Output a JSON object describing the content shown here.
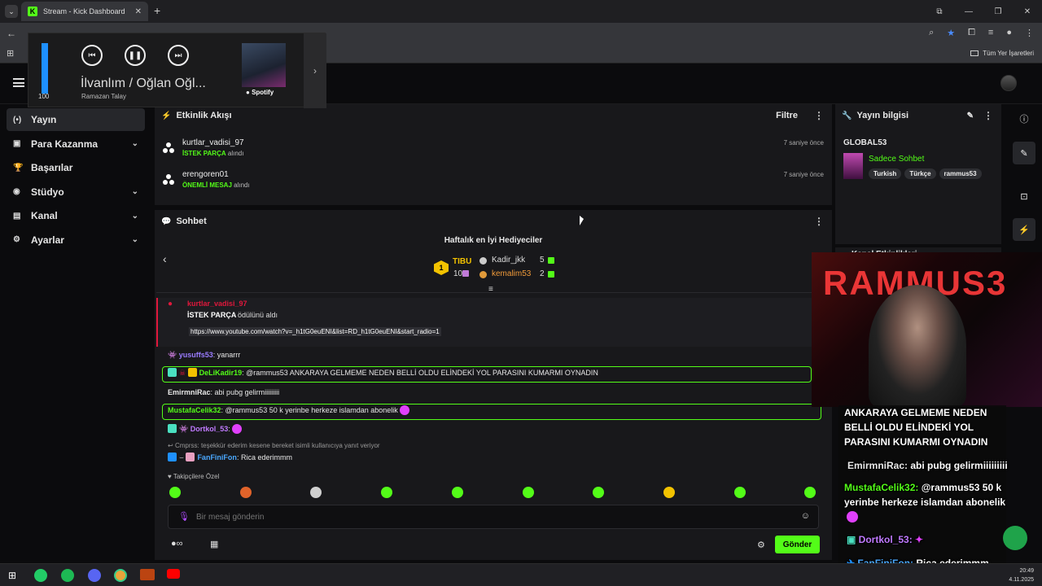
{
  "browser": {
    "tab_title": "Stream - Kick Dashboard",
    "tab_close": "✕",
    "bookmarks_all": "Tüm Yer İşaretleri"
  },
  "spotify": {
    "volume": 100,
    "track": "İlvanlım / Oğlan Oğl...",
    "artist": "Ramazan Talay",
    "brand": "Spotify"
  },
  "sidebar": {
    "items": [
      {
        "label": "Yayın",
        "icon": "broadcast-icon",
        "glyph": "(•)",
        "active": true,
        "expandable": false
      },
      {
        "label": "Para Kazanma",
        "icon": "money-icon",
        "glyph": "▣",
        "active": false,
        "expandable": true
      },
      {
        "label": "Başarılar",
        "icon": "trophy-icon",
        "glyph": "🏆",
        "active": false,
        "expandable": false
      },
      {
        "label": "Stüdyo",
        "icon": "studio-icon",
        "glyph": "◉",
        "active": false,
        "expandable": true
      },
      {
        "label": "Kanal",
        "icon": "channel-icon",
        "glyph": "▤",
        "active": false,
        "expandable": true
      },
      {
        "label": "Ayarlar",
        "icon": "settings-icon",
        "glyph": "⚙",
        "active": false,
        "expandable": true
      }
    ]
  },
  "activity": {
    "title": "Etkinlik Akışı",
    "filter": "Filtre",
    "events": [
      {
        "user": "kurtlar_vadisi_97",
        "kind": "İSTEK PARÇA",
        "suffix": "alındı",
        "time": "7 saniye önce"
      },
      {
        "user": "erengoren01",
        "kind": "ÖNEMLİ MESAJ",
        "suffix": "alındı",
        "time": "7 saniye önce"
      }
    ]
  },
  "chat": {
    "title": "Sohbet",
    "gifters_title": "Haftalık en İyi Hediyeciler",
    "gifters": [
      {
        "name": "TIBU",
        "count": "10",
        "rank": "1"
      },
      {
        "name": "Kadir_jkk",
        "count": "5"
      },
      {
        "name": "kemalim53",
        "count": "2"
      }
    ],
    "redeem": {
      "user": "kurtlar_vadisi_97",
      "kind": "İSTEK PARÇA",
      "suffix": "ödülünü aldı",
      "link": "https://www.youtube.com/watch?v=_h1tG0euENI&list=RD_h1tG0euENI&start_radio=1"
    },
    "messages": [
      {
        "user": "yusuffs53",
        "text": "yanarrr"
      },
      {
        "user": "DeLiKadir19",
        "text": "@rammus53 ANKARAYA GELMEME NEDEN BELLİ OLDU ELİNDEKİ YOL PARASINI KUMARMI OYNADIN"
      },
      {
        "user": "EmirmniRac",
        "text": "abi pubg gelirmiiiiiiiii"
      },
      {
        "user": "MustafaCelik32",
        "text": "@rammus53 50 k yerinbe herkeze islamdan abonelik"
      },
      {
        "user": "Dortkol_53",
        "text": ""
      },
      {
        "user": "FanFiniFon",
        "text": "Rica ederimmm"
      }
    ],
    "reply_note": "Cmprss: teşekkür ederim kesene bereket isimli kullanıcıya yanıt veriyor",
    "followers_only": "Takipçilere Özel",
    "input_placeholder": "Bir mesaj gönderin",
    "send": "Gönder"
  },
  "stream_info": {
    "title": "Yayın bilgisi",
    "stream_title": "GLOBAL53",
    "category": "Sadece Sohbet",
    "tags": [
      "Turkish",
      "Türkçe",
      "rammus53"
    ],
    "next_panel_title": "Kanal Etkinlikleri"
  },
  "overlay": {
    "cam_text": "RAMMUS3",
    "line1": "ANKARAYA GELMEME NEDEN",
    "line2": "BELLİ OLDU ELİNDEKİ YOL",
    "line3": "PARASINI KUMARMI OYNADIN",
    "msg1_user": "EmirmniRac:",
    "msg1_text": "abi pubg gelirmiiiiiiiii",
    "msg2_user": "MustafaCelik32:",
    "msg2_text": "@rammus53 50 k",
    "msg2_text2": "yerinbe herkeze islamdan abonelik",
    "msg3_user": "Dortkol_53:",
    "msg4_user": "FanFiniFon:",
    "msg4_text": "Rica ederimmm"
  },
  "taskbar": {
    "time": "20:49",
    "date": "4.11.2025"
  },
  "colors": {
    "accent": "#53fc18",
    "panel": "#18181b",
    "bg": "#0b0b0d"
  }
}
